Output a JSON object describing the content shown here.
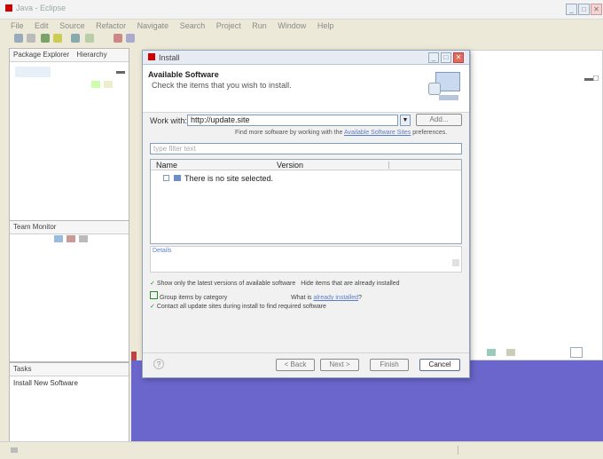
{
  "window": {
    "title": "Java - Eclipse",
    "controls": {
      "minimize": "_",
      "maximize": "□",
      "close": "✕"
    }
  },
  "menubar": [
    "File",
    "Edit",
    "Source",
    "Refactor",
    "Navigate",
    "Search",
    "Project",
    "Run",
    "Window",
    "Help"
  ],
  "left_top_panel": {
    "tabs": [
      "Package Explorer",
      "Hierarchy"
    ]
  },
  "left_mid_panel": {
    "tab": "Team Monitor"
  },
  "left_bottom_panel": {
    "tab": "Tasks",
    "content": "Install New Software"
  },
  "dialog": {
    "title": "Install",
    "heading": "Available Software",
    "subheading": "Check the items that you wish to install.",
    "work_with_label": "Work with:",
    "work_with_value": "http://update.site",
    "add_button": "Add...",
    "find_more_prefix": "Find more software by working with the",
    "find_more_link": "Available Software Sites",
    "find_more_suffix": "preferences.",
    "filter_placeholder": "type filter text",
    "columns": [
      "Name",
      "Version"
    ],
    "rows": [
      {
        "name": "There is no site selected."
      }
    ],
    "details_label": "Details",
    "opt1": "Show only the latest versions of available software",
    "opt2": "Hide items that are already installed",
    "opt3": "Group items by category",
    "opt3_link_prefix": "What is",
    "opt3_link": "already installed",
    "opt3_suffix": "?",
    "opt4": "Contact all update sites during install to find required software",
    "buttons": {
      "back": "< Back",
      "next": "Next >",
      "finish": "Finish",
      "cancel": "Cancel"
    },
    "help_icon": "help-icon"
  },
  "statusbar": {
    "left": "",
    "divider": ""
  }
}
